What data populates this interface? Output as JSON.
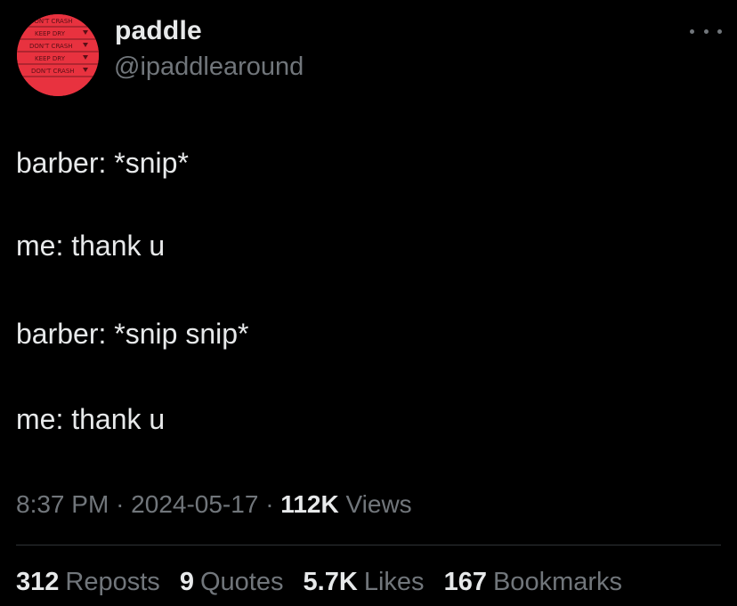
{
  "author": {
    "display_name": "paddle",
    "handle": "@ipaddlearound",
    "avatar_lines": [
      "DON'T CRASH",
      "KEEP DRY",
      "DON'T CRASH",
      "KEEP DRY",
      "DON'T CRASH"
    ],
    "avatar_color": "#e8323f"
  },
  "more_icon": "more-horizontal-icon",
  "tweet": {
    "lines": [
      "barber: *snip*",
      "me: thank u",
      "barber: *snip snip*",
      "me: thank u"
    ]
  },
  "meta": {
    "time": "8:37 PM",
    "separator": "·",
    "date": "2024-05-17",
    "views_count": "112K",
    "views_label": "Views"
  },
  "stats": {
    "reposts_count": "312",
    "reposts_label": "Reposts",
    "quotes_count": "9",
    "quotes_label": "Quotes",
    "likes_count": "5.7K",
    "likes_label": "Likes",
    "bookmarks_count": "167",
    "bookmarks_label": "Bookmarks"
  }
}
